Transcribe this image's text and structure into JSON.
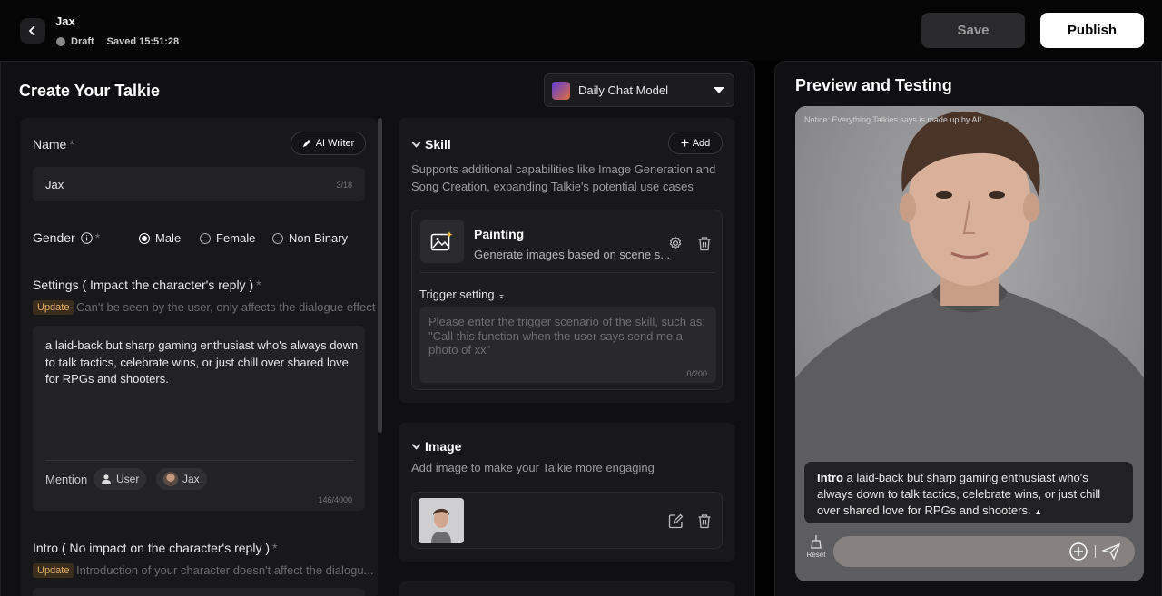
{
  "header": {
    "title": "Jax",
    "status": "Draft",
    "saved": "Saved 15:51:28",
    "save_label": "Save",
    "publish_label": "Publish"
  },
  "create": {
    "title": "Create Your Talkie",
    "model": "Daily Chat Model"
  },
  "form": {
    "name_label": "Name",
    "required": "*",
    "ai_writer": "AI Writer",
    "name_value": "Jax",
    "name_count": "3/18",
    "gender_label": "Gender",
    "gender_options": [
      "Male",
      "Female",
      "Non-Binary"
    ],
    "gender_selected": "Male",
    "settings_label": "Settings ( Impact the character's reply )",
    "update_tag": "Update",
    "settings_hint": "Can't be seen by the user, only affects the dialogue effect",
    "settings_text": "a laid-back but sharp gaming enthusiast who's always down to talk tactics, celebrate wins, or just chill over shared love for RPGs and shooters.",
    "mention_label": "Mention",
    "mention_user": "User",
    "mention_char": "Jax",
    "settings_count": "146/4000",
    "intro_label": "Intro ( No impact on the character's reply )",
    "intro_hint": "Introduction of your character doesn't affect the dialogu..."
  },
  "skill": {
    "title": "Skill",
    "add_label": "Add",
    "description": "Supports additional capabilities like Image Generation and Song Creation, expanding Talkie's potential use cases",
    "item_name": "Painting",
    "item_desc": "Generate images based on scene s...",
    "trigger_label": "Trigger setting",
    "trigger_placeholder": "Please enter the trigger scenario of the skill, such as: \"Call this function when the user says send me a photo of xx\"",
    "trigger_count": "0/200"
  },
  "image": {
    "title": "Image",
    "description": "Add image to make your Talkie more engaging"
  },
  "preview": {
    "title": "Preview and Testing",
    "notice": "Notice: Everything Talkies says is made up by AI!",
    "intro_bold": "Intro",
    "intro_text": "a laid-back but sharp gaming enthusiast who's always down to talk tactics, celebrate wins, or just chill over shared love for RPGs and shooters.",
    "reset_label": "Reset"
  },
  "colors": {
    "accent_tag": "#e3b06a",
    "background": "#000000",
    "panel": "#101012"
  }
}
